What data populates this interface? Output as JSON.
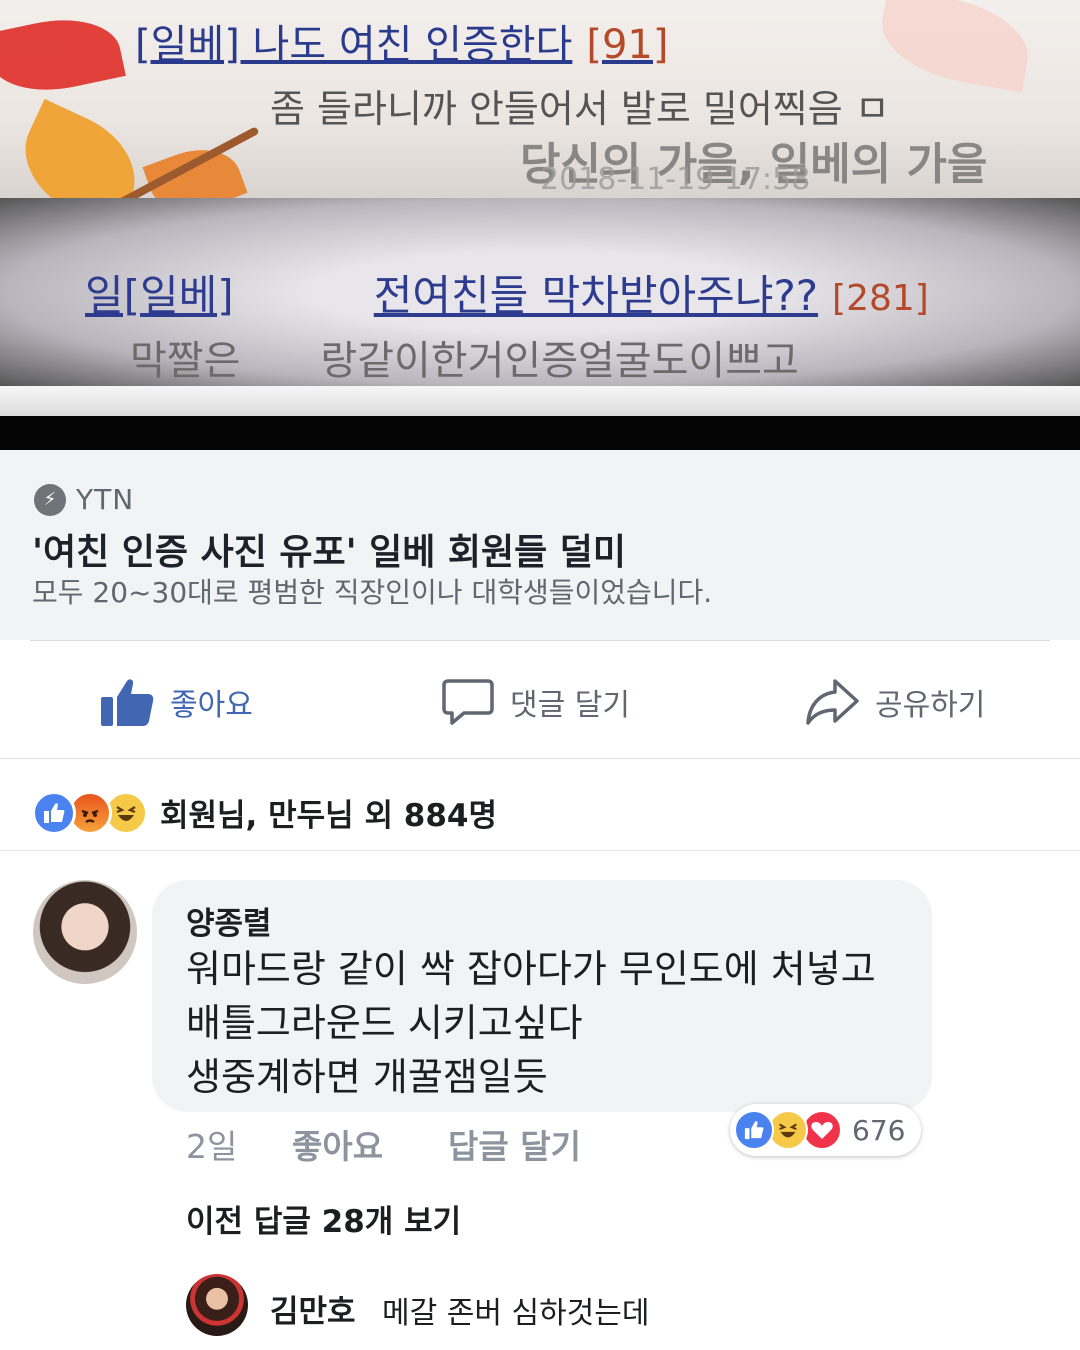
{
  "article_image": {
    "line1_title": "[일베] 나도 여친 인증한다",
    "line1_count": "[91]",
    "line2": "좀 들라니까 안들어서 발로 밀어찍음 ㅁ",
    "line3": "당신의 가을, 일베의 가을",
    "line4": "2018-11-19 17:58",
    "line5_prefix": "일[일베]",
    "line5_title": "전여친들 막차받아주냐??",
    "line5_count": "[281]",
    "line6_prefix": "막짤은",
    "line6_rest": "랑같이한거인증얼굴도이쁘고"
  },
  "link_preview": {
    "source": "YTN",
    "headline": "'여친 인증 사진 유포' 일베 회원들 덜미",
    "description": "모두 20~30대로 평범한 직장인이나 대학생들이었습니다."
  },
  "actions": {
    "like": "좋아요",
    "comment": "댓글 달기",
    "share": "공유하기"
  },
  "reactions_summary": {
    "text": "회원님, 만두님 외 884명",
    "icons": [
      "like-icon",
      "angry-icon",
      "haha-icon"
    ],
    "colors": {
      "like": "#4a83f0",
      "angry": "#e9541c",
      "haha": "#f7c948"
    }
  },
  "comment": {
    "author": "양종렬",
    "lines": [
      "워마드랑 같이 싹 잡아다가 무인도에 처넣고",
      "배틀그라운드 시키고싶다",
      "생중계하면 개꿀잼일듯"
    ],
    "time": "2일",
    "like_label": "좋아요",
    "reply_label": "답글 달기",
    "reaction_count": "676",
    "reaction_icons": [
      "like-icon",
      "haha-icon",
      "love-icon"
    ]
  },
  "previous_replies": "이전 답글 28개 보기",
  "reply": {
    "author": "김만호",
    "text": "메갈 존버 심하것는데"
  }
}
